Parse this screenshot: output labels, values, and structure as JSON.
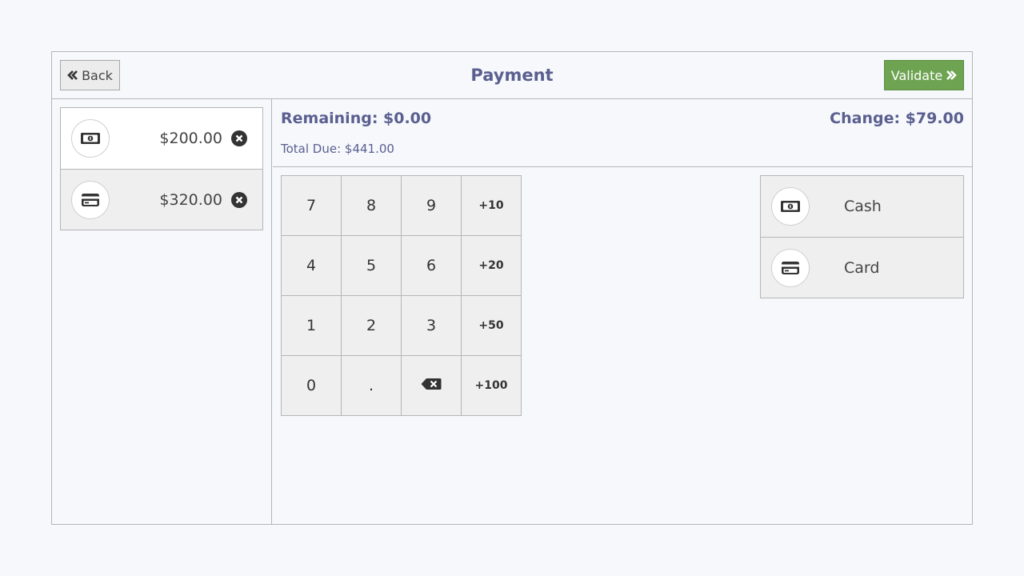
{
  "header": {
    "back_label": "Back",
    "title": "Payment",
    "validate_label": "Validate"
  },
  "payment_lines": [
    {
      "icon": "cash-icon",
      "amount": "$200.00",
      "selected": true
    },
    {
      "icon": "card-icon",
      "amount": "$320.00",
      "selected": false
    }
  ],
  "summary": {
    "remaining": "Remaining: $0.00",
    "change": "Change: $79.00",
    "total_due": "Total Due: $441.00"
  },
  "numpad": {
    "keys": [
      "7",
      "8",
      "9",
      "+10",
      "4",
      "5",
      "6",
      "+20",
      "1",
      "2",
      "3",
      "+50",
      "0",
      ".",
      "backspace-icon",
      "+100"
    ]
  },
  "payment_methods": [
    {
      "icon": "cash-icon",
      "label": "Cash"
    },
    {
      "icon": "card-icon",
      "label": "Card"
    }
  ],
  "colors": {
    "accent": "#5a5f8f",
    "validate": "#6ea352",
    "background": "#f6f8fc"
  }
}
